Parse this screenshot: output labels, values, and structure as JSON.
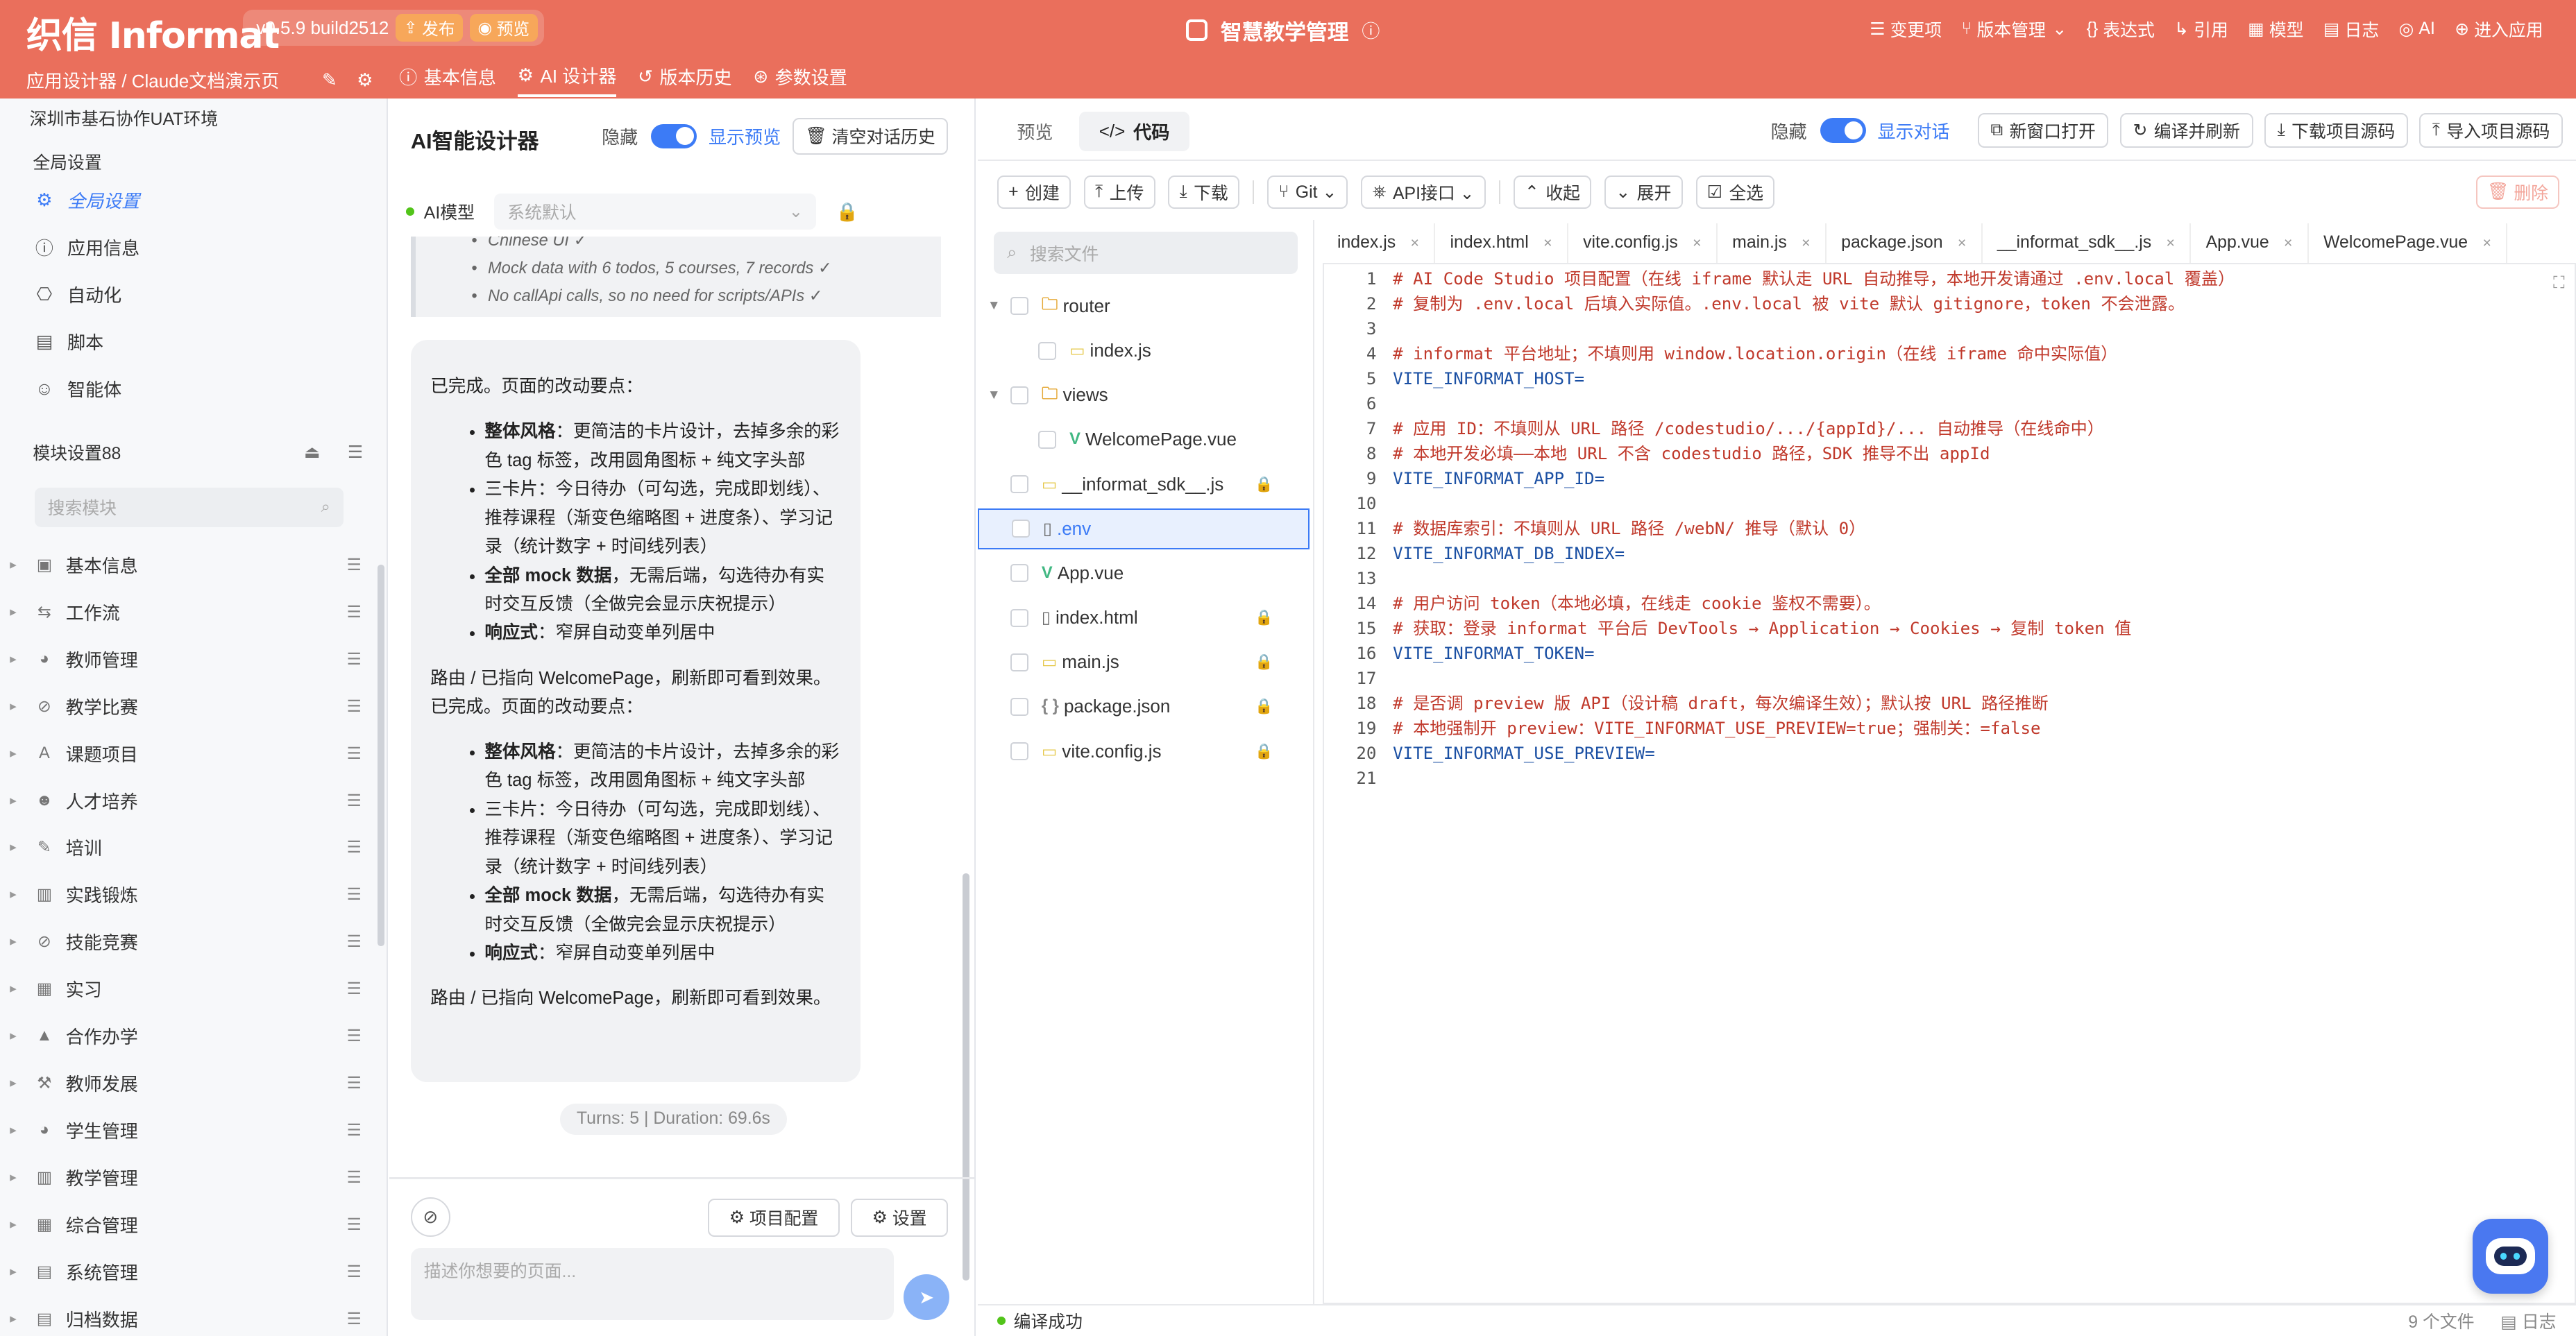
{
  "app": {
    "logo": "织信 Informat",
    "version": "v0.5.9 build2512",
    "publish_label": "发布",
    "preview_label": "预览",
    "title": "智慧教学管理",
    "menu": [
      {
        "icon": "☰",
        "label": "变更项"
      },
      {
        "icon": "⑂",
        "label": "版本管理"
      },
      {
        "icon": "{}",
        "label": "表达式"
      },
      {
        "icon": "↳",
        "label": "引用"
      },
      {
        "icon": "▦",
        "label": "模型"
      },
      {
        "icon": "▤",
        "label": "日志"
      },
      {
        "icon": "◎",
        "label": "AI"
      },
      {
        "icon": "⊕",
        "label": "进入应用"
      }
    ]
  },
  "subnav": {
    "breadcrumb": "应用设计器 / Claude文档演示页",
    "tabs": [
      {
        "icon": "ⓘ",
        "label": "基本信息"
      },
      {
        "icon": "⚙",
        "label": "AI 设计器"
      },
      {
        "icon": "↺",
        "label": "版本历史"
      },
      {
        "icon": "⊛",
        "label": "参数设置"
      }
    ]
  },
  "sidebar": {
    "env": "深圳市基石协作UAT环境",
    "global_section": "全局设置",
    "items": [
      {
        "icon": "⚙",
        "label": "全局设置",
        "active": true
      },
      {
        "icon": "ⓘ",
        "label": "应用信息"
      },
      {
        "icon": "⎔",
        "label": "自动化"
      },
      {
        "icon": "▤",
        "label": "脚本"
      },
      {
        "icon": "☺",
        "label": "智能体"
      }
    ],
    "module_section": "模块设置88",
    "search_placeholder": "搜索模块",
    "modules": [
      {
        "icon": "▣",
        "label": "基本信息"
      },
      {
        "icon": "⇆",
        "label": "工作流"
      },
      {
        "icon": "◕",
        "label": "教师管理"
      },
      {
        "icon": "⊘",
        "label": "教学比赛"
      },
      {
        "icon": "A",
        "label": "课题项目"
      },
      {
        "icon": "☻",
        "label": "人才培养"
      },
      {
        "icon": "✎",
        "label": "培训"
      },
      {
        "icon": "▥",
        "label": "实践锻炼"
      },
      {
        "icon": "⊘",
        "label": "技能竞赛"
      },
      {
        "icon": "▦",
        "label": "实习"
      },
      {
        "icon": "▲",
        "label": "合作办学"
      },
      {
        "icon": "⚒",
        "label": "教师发展"
      },
      {
        "icon": "◕",
        "label": "学生管理"
      },
      {
        "icon": "▥",
        "label": "教学管理"
      },
      {
        "icon": "▦",
        "label": "综合管理"
      },
      {
        "icon": "▤",
        "label": "系统管理"
      },
      {
        "icon": "▤",
        "label": "归档数据"
      }
    ]
  },
  "ai": {
    "title": "AI智能设计器",
    "hide_label": "隐藏",
    "show_preview_label": "显示预览",
    "clear_label": "清空对话历史",
    "model_label": "AI模型",
    "model_placeholder": "系统默认",
    "summary_lines": [
      "Chinese UI ✓",
      "Mock data with 6 todos, 5 courses, 7 records ✓",
      "No callApi calls, so no need for scripts/APIs ✓"
    ],
    "message": {
      "intro": "已完成。页面的改动要点：",
      "bullets": [
        {
          "bold": "整体风格",
          "text": "：更简洁的卡片设计，去掉多余的彩色 tag 标签，改用圆角图标 + 纯文字头部"
        },
        {
          "bold": "",
          "text": "三卡片：今日待办（可勾选，完成即划线）、推荐课程（渐变色缩略图 + 进度条）、学习记录（统计数字 + 时间线列表）"
        },
        {
          "bold": "全部 mock 数据",
          "text": "，无需后端，勾选待办有实时交互反馈（全做完会显示庆祝提示）"
        },
        {
          "bold": "响应式",
          "text": "：窄屏自动变单列居中"
        }
      ],
      "mid": "路由 / 已指向 WelcomePage，刷新即可看到效果。已完成。页面的改动要点：",
      "outro": "路由 / 已指向 WelcomePage，刷新即可看到效果。"
    },
    "stats": "Turns: 5 | Duration: 69.6s",
    "project_config_label": "项目配置",
    "settings_label": "设置",
    "input_placeholder": "描述你想要的页面..."
  },
  "editor": {
    "tabs": [
      {
        "icon": "",
        "label": "预览"
      },
      {
        "icon": "</>",
        "label": "代码"
      }
    ],
    "hide_label": "隐藏",
    "show_chat_label": "显示对话",
    "actions": [
      {
        "icon": "⧉",
        "label": "新窗口打开"
      },
      {
        "icon": "↻",
        "label": "编译并刷新"
      },
      {
        "icon": "⤓",
        "label": "下载项目源码"
      },
      {
        "icon": "⤒",
        "label": "导入项目源码"
      }
    ],
    "toolbar": [
      {
        "icon": "+",
        "label": "创建"
      },
      {
        "icon": "⤒",
        "label": "上传"
      },
      {
        "icon": "⤓",
        "label": "下载"
      },
      {
        "icon": "⑂",
        "label": "Git ⌄"
      },
      {
        "icon": "⎈",
        "label": "API接口 ⌄"
      },
      {
        "icon": "⌃",
        "label": "收起"
      },
      {
        "icon": "⌄",
        "label": "展开"
      },
      {
        "icon": "☑",
        "label": "全选"
      }
    ],
    "delete_label": "删除",
    "file_search_placeholder": "搜索文件",
    "tree": [
      {
        "type": "folder",
        "label": "router",
        "level": 0,
        "open": true
      },
      {
        "type": "js",
        "label": "index.js",
        "level": 1
      },
      {
        "type": "folder",
        "label": "views",
        "level": 0,
        "open": true
      },
      {
        "type": "vue",
        "label": "WelcomePage.vue",
        "level": 1
      },
      {
        "type": "js",
        "label": "__informat_sdk__.js",
        "level": 0,
        "locked": true
      },
      {
        "type": "file",
        "label": ".env",
        "level": 0,
        "selected": true
      },
      {
        "type": "vue",
        "label": "App.vue",
        "level": 0
      },
      {
        "type": "file",
        "label": "index.html",
        "level": 0,
        "locked": true
      },
      {
        "type": "js",
        "label": "main.js",
        "level": 0,
        "locked": true
      },
      {
        "type": "json",
        "label": "package.json",
        "level": 0,
        "locked": true
      },
      {
        "type": "js",
        "label": "vite.config.js",
        "level": 0,
        "locked": true
      }
    ],
    "file_tabs": [
      "index.js",
      "index.html",
      "vite.config.js",
      "main.js",
      "package.json",
      "__informat_sdk__.js",
      "App.vue",
      "WelcomePage.vue"
    ],
    "code": [
      "# AI Code Studio 项目配置（在线 iframe 默认走 URL 自动推导，本地开发请通过 .env.local 覆盖）",
      "# 复制为 .env.local 后填入实际值。.env.local 被 vite 默认 gitignore，token 不会泄露。",
      "",
      "# informat 平台地址；不填则用 window.location.origin（在线 iframe 命中实际值）",
      "VITE_INFORMAT_HOST=",
      "",
      "# 应用 ID：不填则从 URL 路径 /codestudio/.../{appId}/... 自动推导（在线命中）",
      "# 本地开发必填——本地 URL 不含 codestudio 路径，SDK 推导不出 appId",
      "VITE_INFORMAT_APP_ID=",
      "",
      "# 数据库索引：不填则从 URL 路径 /webN/ 推导（默认 0）",
      "VITE_INFORMAT_DB_INDEX=",
      "",
      "# 用户访问 token（本地必填，在线走 cookie 鉴权不需要）。",
      "# 获取：登录 informat 平台后 DevTools → Application → Cookies → 复制 token 值",
      "VITE_INFORMAT_TOKEN=",
      "",
      "# 是否调 preview 版 API（设计稿 draft，每次编译生效）；默认按 URL 路径推断",
      "# 本地强制开 preview：VITE_INFORMAT_USE_PREVIEW=true；强制关：=false",
      "VITE_INFORMAT_USE_PREVIEW=",
      ""
    ],
    "status": "编译成功",
    "file_count": "9 个文件",
    "log_label": "日志"
  },
  "colors": {
    "brand": "#ea6f5c",
    "accent": "#3c7bf6",
    "success": "#52c41a"
  }
}
